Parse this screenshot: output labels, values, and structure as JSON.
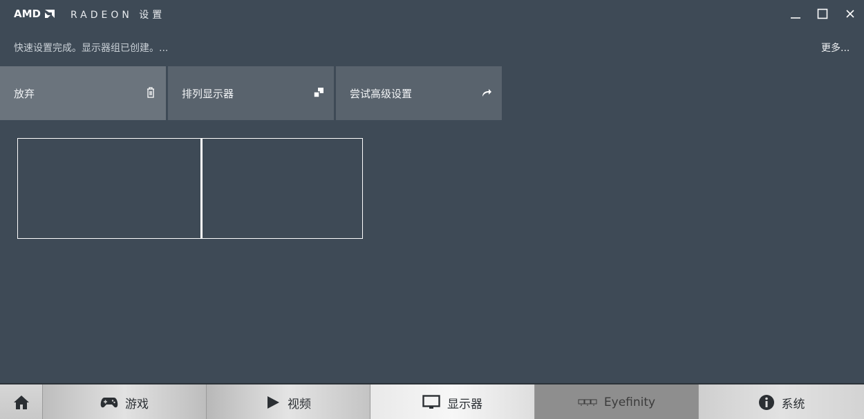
{
  "header": {
    "logo": "AMD",
    "title": "RADEON 设置",
    "window_controls": {
      "minimize": "minimize-icon",
      "maximize": "maximize-icon",
      "close": "close-icon"
    }
  },
  "status": {
    "message": "快速设置完成。显示器组已创建。...",
    "more_label": "更多..."
  },
  "tiles": [
    {
      "label": "放弃",
      "icon": "trash-icon"
    },
    {
      "label": "排列显示器",
      "icon": "arrange-icon"
    },
    {
      "label": "尝试高级设置",
      "icon": "share-arrow-icon"
    }
  ],
  "displays": {
    "count": 2
  },
  "nav": {
    "home": {
      "icon": "home-icon"
    },
    "games": {
      "label": "游戏",
      "icon": "gamepad-icon"
    },
    "video": {
      "label": "视频",
      "icon": "play-icon"
    },
    "display": {
      "label": "显示器",
      "icon": "monitor-icon"
    },
    "eyefinity": {
      "label": "Eyefinity",
      "icon": "eyefinity-icon"
    },
    "system": {
      "label": "系统",
      "icon": "info-icon"
    }
  }
}
